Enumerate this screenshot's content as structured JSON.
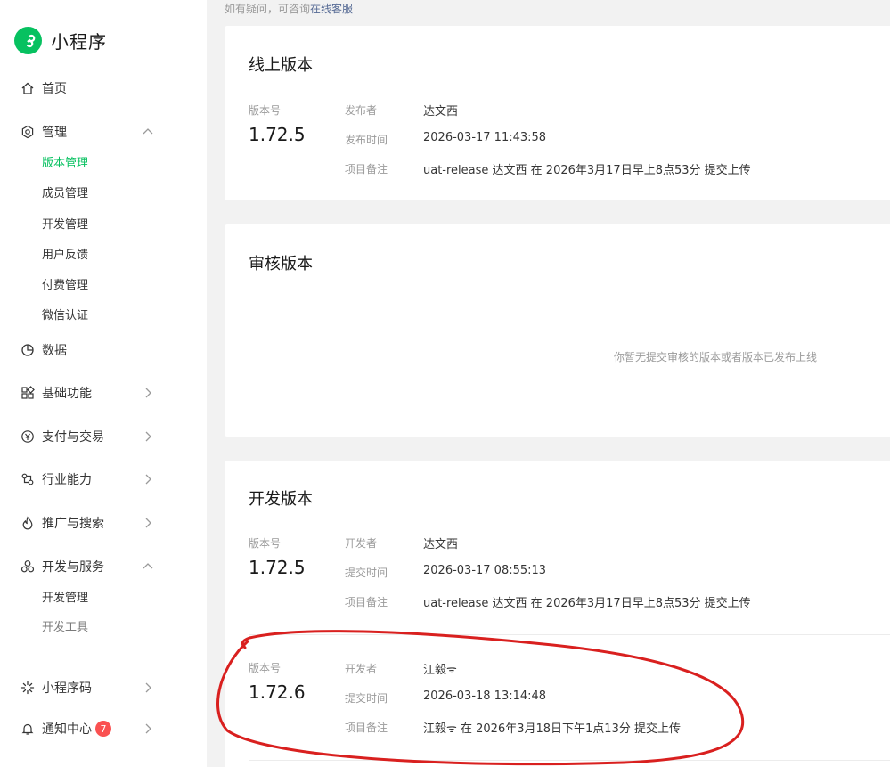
{
  "app": {
    "name": "小程序",
    "brand_color": "#07c160"
  },
  "sidebar": {
    "home": "首页",
    "manage": "管理",
    "manage_items": [
      "版本管理",
      "成员管理",
      "开发管理",
      "用户反馈",
      "付费管理",
      "微信认证"
    ],
    "data": "数据",
    "basic": "基础功能",
    "payment": "支付与交易",
    "industry": "行业能力",
    "promotion": "推广与搜索",
    "devservice": "开发与服务",
    "dev_items": [
      "开发管理",
      "开发工具"
    ],
    "qrcode": "小程序码",
    "notify": "通知中心",
    "notify_count": "7"
  },
  "top_note": {
    "text": "如有疑问，可咨询",
    "link": "在线客服"
  },
  "online": {
    "title": "线上版本",
    "version_label": "版本号",
    "version": "1.72.5",
    "rows": [
      {
        "key": "发布者",
        "value": "达文西"
      },
      {
        "key": "发布时间",
        "value": "2026-03-17 11:43:58"
      },
      {
        "key": "项目备注",
        "value": "uat-release 达文西 在 2026年3月17日早上8点53分 提交上传"
      }
    ]
  },
  "review": {
    "title": "审核版本",
    "empty": "你暂无提交审核的版本或者版本已发布上线"
  },
  "dev": {
    "title": "开发版本",
    "items": [
      {
        "version_label": "版本号",
        "version": "1.72.5",
        "rows": [
          {
            "key": "开发者",
            "value": "达文西"
          },
          {
            "key": "提交时间",
            "value": "2026-03-17 08:55:13"
          },
          {
            "key": "项目备注",
            "value": "uat-release 达文西 在 2026年3月17日早上8点53分 提交上传"
          }
        ]
      },
      {
        "version_label": "版本号",
        "version": "1.72.6",
        "rows": [
          {
            "key": "开发者",
            "value": "江毅ᯤ"
          },
          {
            "key": "提交时间",
            "value": "2026-03-18 13:14:48"
          },
          {
            "key": "项目备注",
            "value": "江毅ᯤ 在 2026年3月18日下午1点13分 提交上传"
          }
        ]
      }
    ]
  },
  "annotation_color": "#d9201f"
}
